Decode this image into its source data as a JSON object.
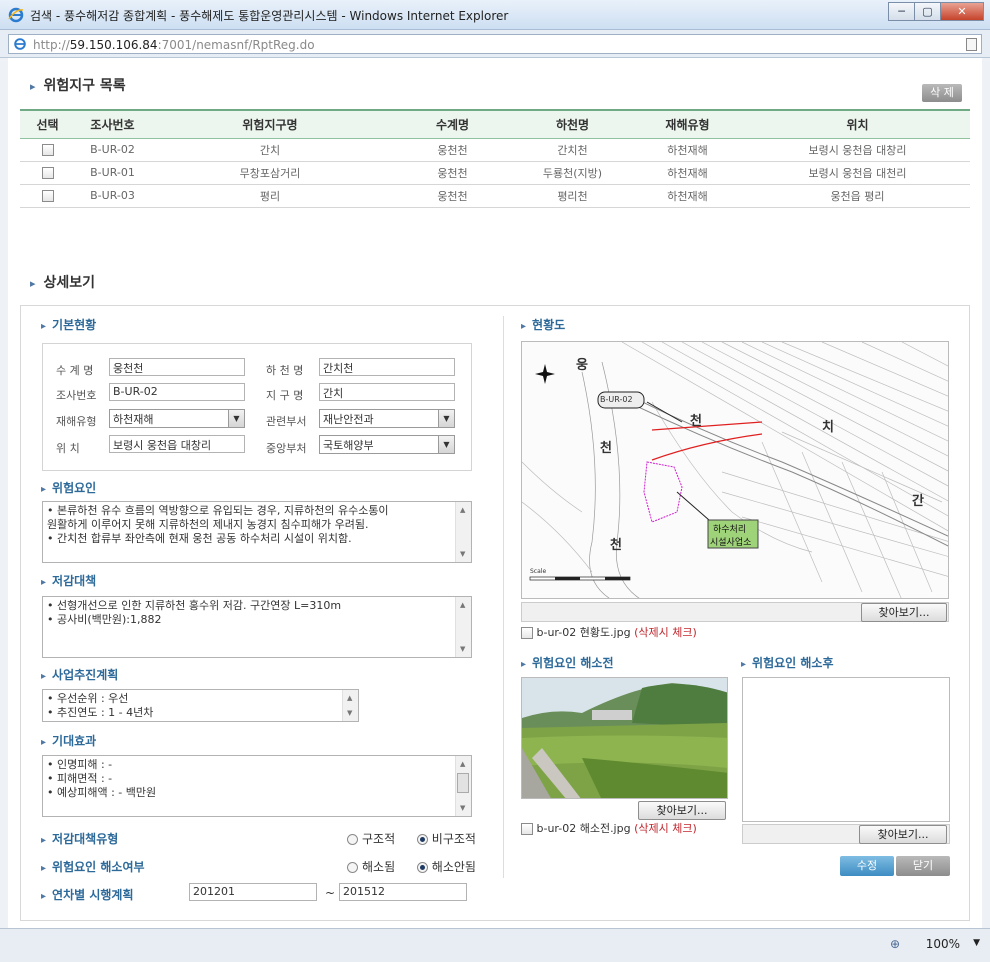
{
  "window": {
    "title": "검색 - 풍수해저감 종합계획 - 풍수해제도 통합운영관리시스템 - Windows Internet Explorer",
    "url_prefix": "http://",
    "url_host": "59.150.106.84",
    "url_path": ":7001/nemasnf/RptReg.do",
    "minimize": "─",
    "maximize": "▢",
    "close": "✕"
  },
  "list": {
    "title": "위험지구 목록",
    "delete_label": "삭 제",
    "headers": [
      "선택",
      "조사번호",
      "위험지구명",
      "수계명",
      "하천명",
      "재해유형",
      "위치"
    ],
    "rows": [
      {
        "id": "B-UR-02",
        "name": "간치",
        "water": "웅천천",
        "river": "간치천",
        "type": "하천재해",
        "loc": "보령시 웅천읍 대창리"
      },
      {
        "id": "B-UR-01",
        "name": "무창포삼거리",
        "water": "웅천천",
        "river": "두룡천(지방)",
        "type": "하천재해",
        "loc": "보령시 웅천읍 대천리"
      },
      {
        "id": "B-UR-03",
        "name": "평리",
        "water": "웅천천",
        "river": "평리천",
        "type": "하천재해",
        "loc": "웅천읍 평리"
      }
    ]
  },
  "detail": {
    "title": "상세보기",
    "basic": {
      "title": "기본현황",
      "water_label": "수 계 명",
      "water_value": "웅천천",
      "river_label": "하 천 명",
      "river_value": "간치천",
      "survey_label": "조사번호",
      "survey_value": "B-UR-02",
      "district_label": "지 구 명",
      "district_value": "간치",
      "disaster_label": "재해유형",
      "disaster_value": "하천재해",
      "dept_label": "관련부서",
      "dept_value": "재난안전과",
      "location_label": "위    치",
      "location_value": "보령시 웅천읍 대창리",
      "ministry_label": "중앙부처",
      "ministry_value": "국토해양부"
    },
    "risk": {
      "title": "위험요인",
      "line1": "• 본류하천 유수 흐름의 역방향으로 유입되는 경우, 지류하천의 유수소통이",
      "line2": "원활하게 이루어지 못해 지류하천의 제내지 농경지 침수피해가 우려됨.",
      "line3": "• 간치천 합류부 좌안측에 현재 웅천 공동 하수처리 시설이 위치함."
    },
    "measure": {
      "title": "저감대책",
      "line1": "• 선형개선으로 인한 지류하천 홍수위 저감. 구간연장 L=310m",
      "line2": "• 공사비(백만원):1,882"
    },
    "plan": {
      "title": "사업추진계획",
      "line1": "• 우선순위  : 우선",
      "line2": "• 추진연도  : 1 - 4년차"
    },
    "effect": {
      "title": "기대효과",
      "line1": "• 인명피해 : -",
      "line2": "• 피해면적 : -",
      "line3": "• 예상피해액 : - 백만원"
    },
    "measure_type": {
      "title": "저감대책유형",
      "opt1": "구조적",
      "opt2": "비구조적",
      "selected": "비구조적"
    },
    "resolved": {
      "title": "위험요인 해소여부",
      "opt1": "해소됨",
      "opt2": "해소안됨",
      "selected": "해소안됨"
    },
    "yearly": {
      "title": "연차별 시행계획",
      "from": "201201",
      "tilde": "~",
      "to": "201512"
    },
    "map": {
      "title": "현황도",
      "labels": {
        "yong": "웅",
        "cheon1": "천",
        "chi": "치",
        "cheon2": "천",
        "gan": "간",
        "cheon3": "천",
        "tag": "B-UR-02",
        "facility1": "하수처리",
        "facility2": "시설사업소",
        "scale": "Scale"
      },
      "browse": "찾아보기...",
      "file": "b-ur-02 현황도.jpg",
      "del_note": "(삭제시 체크)"
    },
    "before": {
      "title": "위험요인 해소전",
      "browse": "찾아보기...",
      "file": "b-ur-02 해소전.jpg",
      "del_note": "(삭제시 체크)"
    },
    "after": {
      "title": "위험요인 해소후",
      "browse": "찾아보기..."
    },
    "edit_label": "수정",
    "close_label": "닫기"
  },
  "status": {
    "zoom": "100%"
  }
}
